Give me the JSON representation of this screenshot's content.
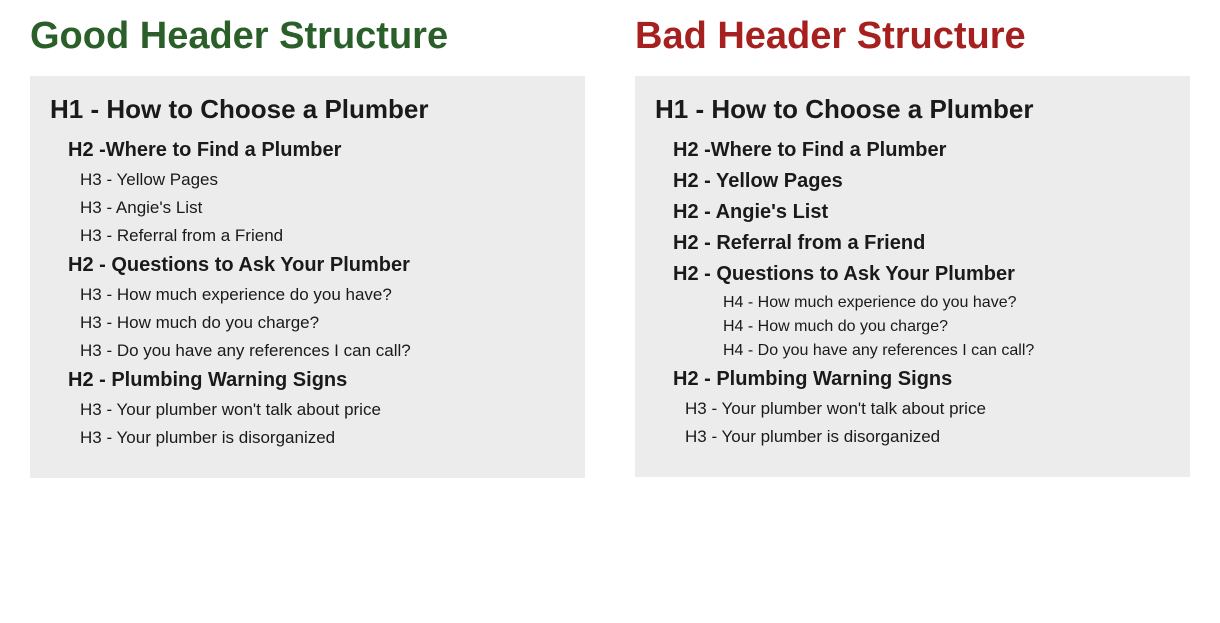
{
  "good": {
    "title": "Good Header Structure",
    "items": [
      {
        "cls": "h1line",
        "text": "H1 - How to Choose a Plumber"
      },
      {
        "cls": "h2line",
        "text": "H2 -Where to Find a  Plumber"
      },
      {
        "cls": "h3line",
        "text": "H3 - Yellow Pages"
      },
      {
        "cls": "h3line",
        "text": "H3 - Angie's List"
      },
      {
        "cls": "h3line",
        "text": "H3 - Referral from a Friend"
      },
      {
        "cls": "h2line",
        "text": "H2 - Questions to Ask Your Plumber"
      },
      {
        "cls": "h3line",
        "text": "H3 - How much experience do you have?"
      },
      {
        "cls": "h3line",
        "text": "H3 - How much do you charge?"
      },
      {
        "cls": "h3line",
        "text": "H3 - Do you have any references I can call?"
      },
      {
        "cls": "h2line",
        "text": "H2 - Plumbing Warning Signs"
      },
      {
        "cls": "h3line",
        "text": "H3 - Your plumber won't talk about price"
      },
      {
        "cls": "h3line",
        "text": "H3 - Your plumber is disorganized"
      }
    ]
  },
  "bad": {
    "title": "Bad Header Structure",
    "items": [
      {
        "cls": "h1line",
        "text": "H1 - How to Choose a Plumber"
      },
      {
        "cls": "h2line",
        "text": "H2 -Where to Find a  Plumber"
      },
      {
        "cls": "h2line",
        "text": "H2 - Yellow Pages"
      },
      {
        "cls": "h2line",
        "text": "H2 - Angie's List"
      },
      {
        "cls": "h2line",
        "text": "H2 - Referral from a Friend"
      },
      {
        "cls": "h2line",
        "text": "H2 - Questions to Ask Your Plumber"
      },
      {
        "cls": "h4line",
        "text": "H4 - How much experience do you have?"
      },
      {
        "cls": "h4line",
        "text": "H4 - How much do you charge?"
      },
      {
        "cls": "h4line",
        "text": "H4 - Do you have any references I can call?"
      },
      {
        "cls": "h2line",
        "text": "H2 - Plumbing Warning Signs"
      },
      {
        "cls": "h3line",
        "text": "H3 - Your plumber won't talk about price"
      },
      {
        "cls": "h3line",
        "text": "H3 - Your plumber is disorganized"
      }
    ]
  }
}
